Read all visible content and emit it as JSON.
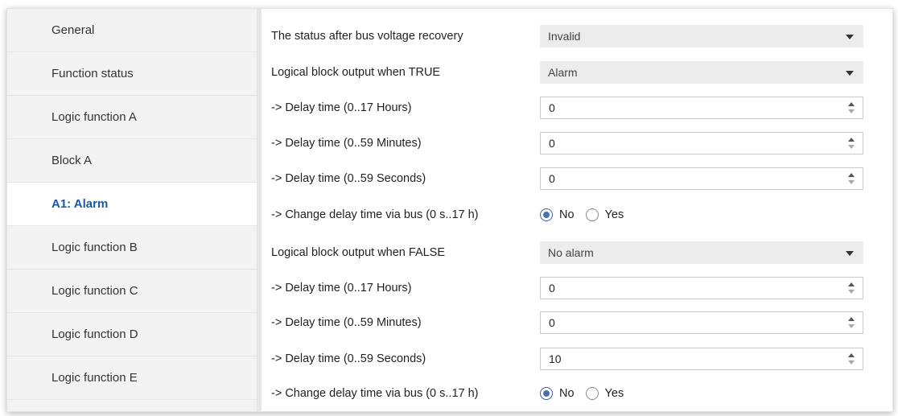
{
  "sidebar": {
    "items": [
      {
        "label": "General"
      },
      {
        "label": "Function status"
      },
      {
        "label": "Logic function A"
      },
      {
        "label": "Block A"
      },
      {
        "label": "A1: Alarm",
        "active": true
      },
      {
        "label": "Logic function B"
      },
      {
        "label": "Logic function C"
      },
      {
        "label": "Logic function D"
      },
      {
        "label": "Logic function E"
      }
    ]
  },
  "params": {
    "status_recovery": {
      "label": "The status after bus voltage recovery",
      "value": "Invalid"
    },
    "true_output": {
      "label": "Logical block output when TRUE",
      "value": "Alarm"
    },
    "true_hours": {
      "label": "-> Delay time (0..17 Hours)",
      "value": "0"
    },
    "true_minutes": {
      "label": "-> Delay time (0..59 Minutes)",
      "value": "0"
    },
    "true_seconds": {
      "label": "-> Delay time (0..59 Seconds)",
      "value": "0"
    },
    "true_change_via_bus": {
      "label": "-> Change delay time via bus (0 s..17 h)",
      "no": "No",
      "yes": "Yes",
      "selected": "No"
    },
    "false_output": {
      "label": "Logical block output when FALSE",
      "value": "No alarm"
    },
    "false_hours": {
      "label": "-> Delay time (0..17 Hours)",
      "value": "0"
    },
    "false_minutes": {
      "label": "-> Delay time (0..59 Minutes)",
      "value": "0"
    },
    "false_seconds": {
      "label": "-> Delay time (0..59 Seconds)",
      "value": "10"
    },
    "false_change_via_bus": {
      "label": "-> Change delay time via bus (0 s..17 h)",
      "no": "No",
      "yes": "Yes",
      "selected": "No"
    }
  },
  "icons": {
    "dropdown": "chevron-down-icon",
    "spinner_up": "spin-up-icon",
    "spinner_down": "spin-down-icon"
  },
  "colors": {
    "active_item": "#1a5aa0",
    "radio_selected": "#4a6fb5"
  }
}
